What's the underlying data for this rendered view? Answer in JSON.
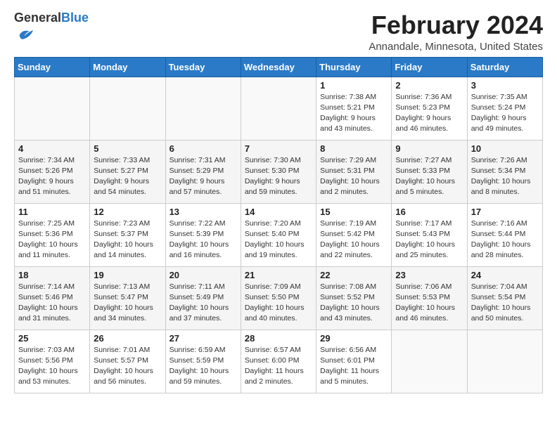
{
  "header": {
    "logo_general": "General",
    "logo_blue": "Blue",
    "month_title": "February 2024",
    "location": "Annandale, Minnesota, United States"
  },
  "weekdays": [
    "Sunday",
    "Monday",
    "Tuesday",
    "Wednesday",
    "Thursday",
    "Friday",
    "Saturday"
  ],
  "weeks": [
    [
      {
        "day": "",
        "info": ""
      },
      {
        "day": "",
        "info": ""
      },
      {
        "day": "",
        "info": ""
      },
      {
        "day": "",
        "info": ""
      },
      {
        "day": "1",
        "info": "Sunrise: 7:38 AM\nSunset: 5:21 PM\nDaylight: 9 hours\nand 43 minutes."
      },
      {
        "day": "2",
        "info": "Sunrise: 7:36 AM\nSunset: 5:23 PM\nDaylight: 9 hours\nand 46 minutes."
      },
      {
        "day": "3",
        "info": "Sunrise: 7:35 AM\nSunset: 5:24 PM\nDaylight: 9 hours\nand 49 minutes."
      }
    ],
    [
      {
        "day": "4",
        "info": "Sunrise: 7:34 AM\nSunset: 5:26 PM\nDaylight: 9 hours\nand 51 minutes."
      },
      {
        "day": "5",
        "info": "Sunrise: 7:33 AM\nSunset: 5:27 PM\nDaylight: 9 hours\nand 54 minutes."
      },
      {
        "day": "6",
        "info": "Sunrise: 7:31 AM\nSunset: 5:29 PM\nDaylight: 9 hours\nand 57 minutes."
      },
      {
        "day": "7",
        "info": "Sunrise: 7:30 AM\nSunset: 5:30 PM\nDaylight: 9 hours\nand 59 minutes."
      },
      {
        "day": "8",
        "info": "Sunrise: 7:29 AM\nSunset: 5:31 PM\nDaylight: 10 hours\nand 2 minutes."
      },
      {
        "day": "9",
        "info": "Sunrise: 7:27 AM\nSunset: 5:33 PM\nDaylight: 10 hours\nand 5 minutes."
      },
      {
        "day": "10",
        "info": "Sunrise: 7:26 AM\nSunset: 5:34 PM\nDaylight: 10 hours\nand 8 minutes."
      }
    ],
    [
      {
        "day": "11",
        "info": "Sunrise: 7:25 AM\nSunset: 5:36 PM\nDaylight: 10 hours\nand 11 minutes."
      },
      {
        "day": "12",
        "info": "Sunrise: 7:23 AM\nSunset: 5:37 PM\nDaylight: 10 hours\nand 14 minutes."
      },
      {
        "day": "13",
        "info": "Sunrise: 7:22 AM\nSunset: 5:39 PM\nDaylight: 10 hours\nand 16 minutes."
      },
      {
        "day": "14",
        "info": "Sunrise: 7:20 AM\nSunset: 5:40 PM\nDaylight: 10 hours\nand 19 minutes."
      },
      {
        "day": "15",
        "info": "Sunrise: 7:19 AM\nSunset: 5:42 PM\nDaylight: 10 hours\nand 22 minutes."
      },
      {
        "day": "16",
        "info": "Sunrise: 7:17 AM\nSunset: 5:43 PM\nDaylight: 10 hours\nand 25 minutes."
      },
      {
        "day": "17",
        "info": "Sunrise: 7:16 AM\nSunset: 5:44 PM\nDaylight: 10 hours\nand 28 minutes."
      }
    ],
    [
      {
        "day": "18",
        "info": "Sunrise: 7:14 AM\nSunset: 5:46 PM\nDaylight: 10 hours\nand 31 minutes."
      },
      {
        "day": "19",
        "info": "Sunrise: 7:13 AM\nSunset: 5:47 PM\nDaylight: 10 hours\nand 34 minutes."
      },
      {
        "day": "20",
        "info": "Sunrise: 7:11 AM\nSunset: 5:49 PM\nDaylight: 10 hours\nand 37 minutes."
      },
      {
        "day": "21",
        "info": "Sunrise: 7:09 AM\nSunset: 5:50 PM\nDaylight: 10 hours\nand 40 minutes."
      },
      {
        "day": "22",
        "info": "Sunrise: 7:08 AM\nSunset: 5:52 PM\nDaylight: 10 hours\nand 43 minutes."
      },
      {
        "day": "23",
        "info": "Sunrise: 7:06 AM\nSunset: 5:53 PM\nDaylight: 10 hours\nand 46 minutes."
      },
      {
        "day": "24",
        "info": "Sunrise: 7:04 AM\nSunset: 5:54 PM\nDaylight: 10 hours\nand 50 minutes."
      }
    ],
    [
      {
        "day": "25",
        "info": "Sunrise: 7:03 AM\nSunset: 5:56 PM\nDaylight: 10 hours\nand 53 minutes."
      },
      {
        "day": "26",
        "info": "Sunrise: 7:01 AM\nSunset: 5:57 PM\nDaylight: 10 hours\nand 56 minutes."
      },
      {
        "day": "27",
        "info": "Sunrise: 6:59 AM\nSunset: 5:59 PM\nDaylight: 10 hours\nand 59 minutes."
      },
      {
        "day": "28",
        "info": "Sunrise: 6:57 AM\nSunset: 6:00 PM\nDaylight: 11 hours\nand 2 minutes."
      },
      {
        "day": "29",
        "info": "Sunrise: 6:56 AM\nSunset: 6:01 PM\nDaylight: 11 hours\nand 5 minutes."
      },
      {
        "day": "",
        "info": ""
      },
      {
        "day": "",
        "info": ""
      }
    ]
  ]
}
